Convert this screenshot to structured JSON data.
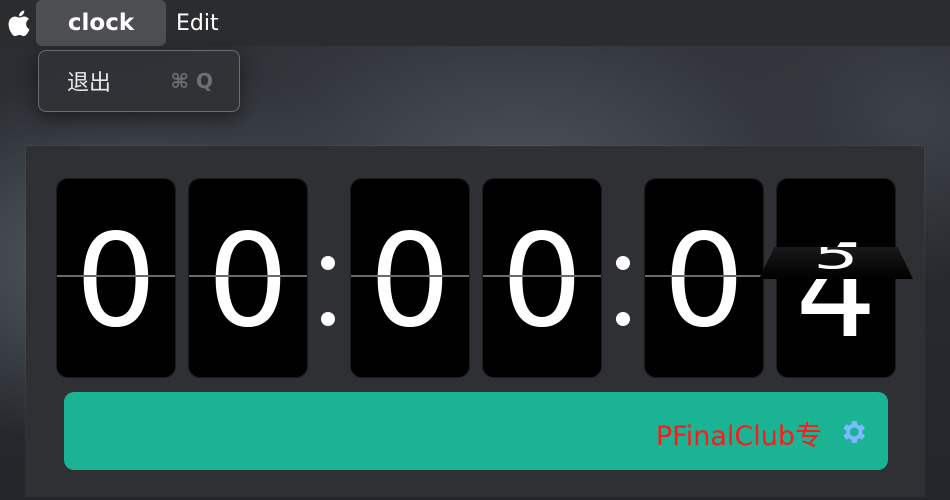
{
  "menubar": {
    "apple_icon": "apple-icon",
    "app_title": "clock",
    "edit_label": "Edit"
  },
  "dropdown": {
    "quit_label": "退出",
    "quit_shortcut": "⌘ Q"
  },
  "clock": {
    "hours": [
      "0",
      "0"
    ],
    "minutes": [
      "0",
      "0"
    ],
    "seconds": [
      "0",
      "4"
    ],
    "next_second_flip": "5",
    "separator": ":"
  },
  "footer": {
    "text": "PFinalClub专",
    "settings_icon": "gear-icon",
    "bar_color": "#1ab394",
    "text_color": "#ff1a1a",
    "icon_color": "#7ab8ff"
  }
}
